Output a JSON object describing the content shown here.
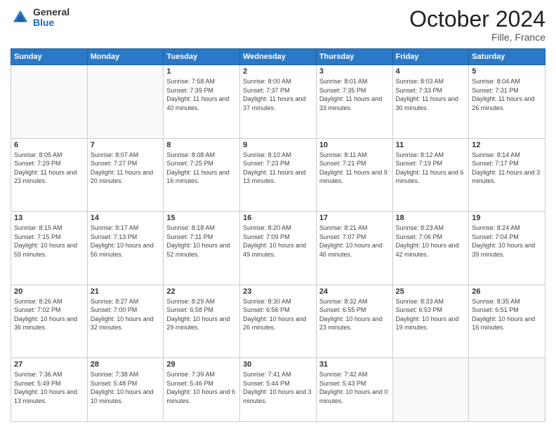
{
  "logo": {
    "general": "General",
    "blue": "Blue"
  },
  "header": {
    "month": "October 2024",
    "location": "Fille, France"
  },
  "weekdays": [
    "Sunday",
    "Monday",
    "Tuesday",
    "Wednesday",
    "Thursday",
    "Friday",
    "Saturday"
  ],
  "weeks": [
    [
      {
        "day": "",
        "sunrise": "",
        "sunset": "",
        "daylight": ""
      },
      {
        "day": "",
        "sunrise": "",
        "sunset": "",
        "daylight": ""
      },
      {
        "day": "1",
        "sunrise": "Sunrise: 7:58 AM",
        "sunset": "Sunset: 7:39 PM",
        "daylight": "Daylight: 11 hours and 40 minutes."
      },
      {
        "day": "2",
        "sunrise": "Sunrise: 8:00 AM",
        "sunset": "Sunset: 7:37 PM",
        "daylight": "Daylight: 11 hours and 37 minutes."
      },
      {
        "day": "3",
        "sunrise": "Sunrise: 8:01 AM",
        "sunset": "Sunset: 7:35 PM",
        "daylight": "Daylight: 11 hours and 33 minutes."
      },
      {
        "day": "4",
        "sunrise": "Sunrise: 8:03 AM",
        "sunset": "Sunset: 7:33 PM",
        "daylight": "Daylight: 11 hours and 30 minutes."
      },
      {
        "day": "5",
        "sunrise": "Sunrise: 8:04 AM",
        "sunset": "Sunset: 7:31 PM",
        "daylight": "Daylight: 11 hours and 26 minutes."
      }
    ],
    [
      {
        "day": "6",
        "sunrise": "Sunrise: 8:05 AM",
        "sunset": "Sunset: 7:29 PM",
        "daylight": "Daylight: 11 hours and 23 minutes."
      },
      {
        "day": "7",
        "sunrise": "Sunrise: 8:07 AM",
        "sunset": "Sunset: 7:27 PM",
        "daylight": "Daylight: 11 hours and 20 minutes."
      },
      {
        "day": "8",
        "sunrise": "Sunrise: 8:08 AM",
        "sunset": "Sunset: 7:25 PM",
        "daylight": "Daylight: 11 hours and 16 minutes."
      },
      {
        "day": "9",
        "sunrise": "Sunrise: 8:10 AM",
        "sunset": "Sunset: 7:23 PM",
        "daylight": "Daylight: 11 hours and 13 minutes."
      },
      {
        "day": "10",
        "sunrise": "Sunrise: 8:11 AM",
        "sunset": "Sunset: 7:21 PM",
        "daylight": "Daylight: 11 hours and 9 minutes."
      },
      {
        "day": "11",
        "sunrise": "Sunrise: 8:12 AM",
        "sunset": "Sunset: 7:19 PM",
        "daylight": "Daylight: 11 hours and 6 minutes."
      },
      {
        "day": "12",
        "sunrise": "Sunrise: 8:14 AM",
        "sunset": "Sunset: 7:17 PM",
        "daylight": "Daylight: 11 hours and 3 minutes."
      }
    ],
    [
      {
        "day": "13",
        "sunrise": "Sunrise: 8:15 AM",
        "sunset": "Sunset: 7:15 PM",
        "daylight": "Daylight: 10 hours and 59 minutes."
      },
      {
        "day": "14",
        "sunrise": "Sunrise: 8:17 AM",
        "sunset": "Sunset: 7:13 PM",
        "daylight": "Daylight: 10 hours and 56 minutes."
      },
      {
        "day": "15",
        "sunrise": "Sunrise: 8:18 AM",
        "sunset": "Sunset: 7:11 PM",
        "daylight": "Daylight: 10 hours and 52 minutes."
      },
      {
        "day": "16",
        "sunrise": "Sunrise: 8:20 AM",
        "sunset": "Sunset: 7:09 PM",
        "daylight": "Daylight: 10 hours and 49 minutes."
      },
      {
        "day": "17",
        "sunrise": "Sunrise: 8:21 AM",
        "sunset": "Sunset: 7:07 PM",
        "daylight": "Daylight: 10 hours and 46 minutes."
      },
      {
        "day": "18",
        "sunrise": "Sunrise: 8:23 AM",
        "sunset": "Sunset: 7:06 PM",
        "daylight": "Daylight: 10 hours and 42 minutes."
      },
      {
        "day": "19",
        "sunrise": "Sunrise: 8:24 AM",
        "sunset": "Sunset: 7:04 PM",
        "daylight": "Daylight: 10 hours and 39 minutes."
      }
    ],
    [
      {
        "day": "20",
        "sunrise": "Sunrise: 8:26 AM",
        "sunset": "Sunset: 7:02 PM",
        "daylight": "Daylight: 10 hours and 36 minutes."
      },
      {
        "day": "21",
        "sunrise": "Sunrise: 8:27 AM",
        "sunset": "Sunset: 7:00 PM",
        "daylight": "Daylight: 10 hours and 32 minutes."
      },
      {
        "day": "22",
        "sunrise": "Sunrise: 8:29 AM",
        "sunset": "Sunset: 6:58 PM",
        "daylight": "Daylight: 10 hours and 29 minutes."
      },
      {
        "day": "23",
        "sunrise": "Sunrise: 8:30 AM",
        "sunset": "Sunset: 6:56 PM",
        "daylight": "Daylight: 10 hours and 26 minutes."
      },
      {
        "day": "24",
        "sunrise": "Sunrise: 8:32 AM",
        "sunset": "Sunset: 6:55 PM",
        "daylight": "Daylight: 10 hours and 23 minutes."
      },
      {
        "day": "25",
        "sunrise": "Sunrise: 8:33 AM",
        "sunset": "Sunset: 6:53 PM",
        "daylight": "Daylight: 10 hours and 19 minutes."
      },
      {
        "day": "26",
        "sunrise": "Sunrise: 8:35 AM",
        "sunset": "Sunset: 6:51 PM",
        "daylight": "Daylight: 10 hours and 16 minutes."
      }
    ],
    [
      {
        "day": "27",
        "sunrise": "Sunrise: 7:36 AM",
        "sunset": "Sunset: 5:49 PM",
        "daylight": "Daylight: 10 hours and 13 minutes."
      },
      {
        "day": "28",
        "sunrise": "Sunrise: 7:38 AM",
        "sunset": "Sunset: 5:48 PM",
        "daylight": "Daylight: 10 hours and 10 minutes."
      },
      {
        "day": "29",
        "sunrise": "Sunrise: 7:39 AM",
        "sunset": "Sunset: 5:46 PM",
        "daylight": "Daylight: 10 hours and 6 minutes."
      },
      {
        "day": "30",
        "sunrise": "Sunrise: 7:41 AM",
        "sunset": "Sunset: 5:44 PM",
        "daylight": "Daylight: 10 hours and 3 minutes."
      },
      {
        "day": "31",
        "sunrise": "Sunrise: 7:42 AM",
        "sunset": "Sunset: 5:43 PM",
        "daylight": "Daylight: 10 hours and 0 minutes."
      },
      {
        "day": "",
        "sunrise": "",
        "sunset": "",
        "daylight": ""
      },
      {
        "day": "",
        "sunrise": "",
        "sunset": "",
        "daylight": ""
      }
    ]
  ]
}
